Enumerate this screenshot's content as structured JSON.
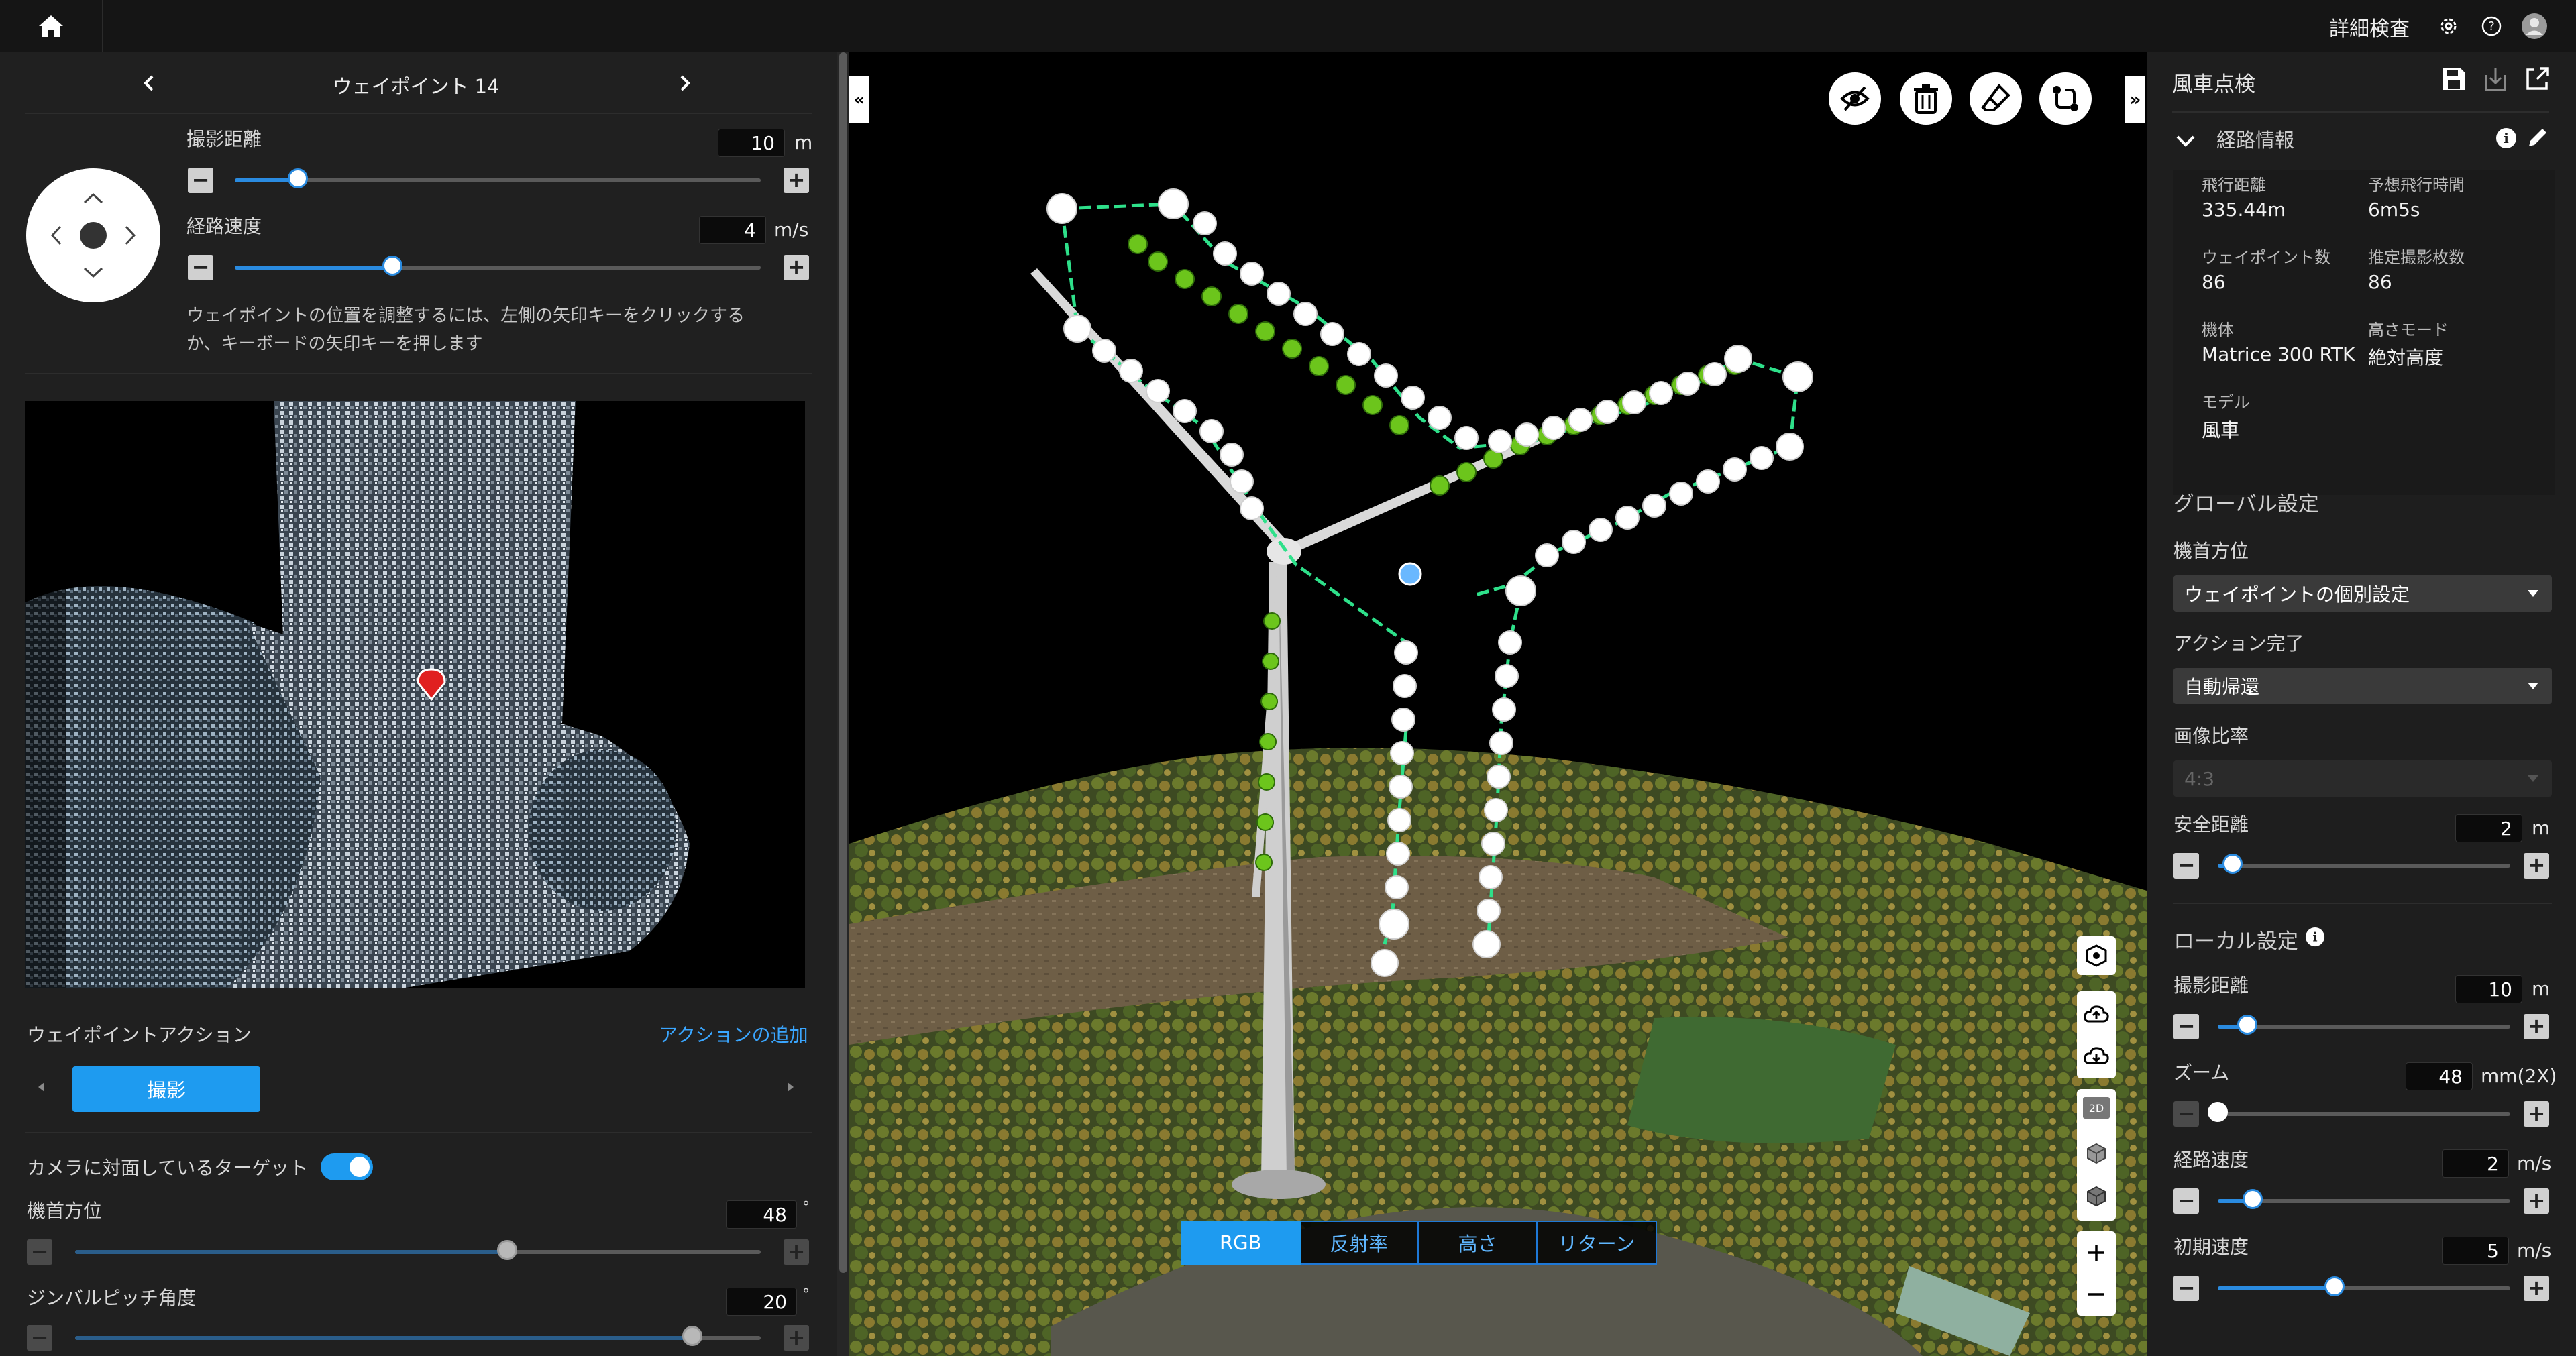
{
  "topbar": {
    "mode_label": "詳細検査",
    "icons": [
      "home-icon",
      "gear-icon",
      "help-icon",
      "user-icon"
    ]
  },
  "left_panel": {
    "title": "ウェイポイント 14",
    "shoot_distance": {
      "label": "撮影距離",
      "value": "10",
      "unit": "m",
      "level": 0.12
    },
    "route_speed": {
      "label": "経路速度",
      "value": "4",
      "unit": "m/s",
      "level": 0.3
    },
    "hint": [
      "ウェイポイントの位置を調整するには、左側の矢印キーをクリックする",
      "か、キーボードの矢印キーを押します"
    ],
    "actions": {
      "label": "ウェイポイントアクション",
      "add_link": "アクションの追加",
      "chip": "撮影"
    },
    "face_target": {
      "label": "カメラに対面しているターゲット",
      "enabled": true
    },
    "heading": {
      "label": "機首方位",
      "value": "48",
      "unit": "°",
      "level": 0.63
    },
    "gimbal_pitch": {
      "label": "ジンバルピッチ角度",
      "value": "20",
      "unit": "°",
      "level": 0.9
    }
  },
  "viewport": {
    "tools": [
      "eye-off-icon",
      "trash-icon",
      "eraser-icon",
      "route-swap-icon"
    ],
    "view_tools": [
      "cube-view-icon",
      "cloud-upload-icon",
      "cloud-download-icon",
      "2d-view-icon",
      "3d-box-icon",
      "3d-box-alt-icon",
      "zoom-in-icon",
      "zoom-out-icon"
    ],
    "view_2d_label": "2D",
    "color_modes": [
      "RGB",
      "反射率",
      "高さ",
      "リターン"
    ],
    "active_mode": "RGB"
  },
  "right_panel": {
    "title": "風車点検",
    "route_info": {
      "title": "経路情報",
      "items": [
        {
          "label": "飛行距離",
          "value": "335.44m"
        },
        {
          "label": "予想飛行時間",
          "value": "6m5s"
        },
        {
          "label": "ウェイポイント数",
          "value": "86"
        },
        {
          "label": "推定撮影枚数",
          "value": "86"
        },
        {
          "label": "機体",
          "value": "Matrice 300 RTK"
        },
        {
          "label": "高さモード",
          "value": "絶対高度"
        },
        {
          "label": "モデル",
          "value": "風車"
        }
      ]
    },
    "global": {
      "title": "グローバル設定",
      "heading_label": "機首方位",
      "heading_value": "ウェイポイントの個別設定",
      "finish_label": "アクション完了",
      "finish_value": "自動帰還",
      "ratio_label": "画像比率",
      "ratio_value": "4:3",
      "safe_distance": {
        "label": "安全距離",
        "value": "2",
        "unit": "m",
        "level": 0.05
      }
    },
    "local": {
      "title": "ローカル設定",
      "shoot_distance": {
        "label": "撮影距離",
        "value": "10",
        "unit": "m",
        "level": 0.1
      },
      "zoom": {
        "label": "ズーム",
        "value": "48",
        "unit": "mm(2X)",
        "level": 0.0
      },
      "route_speed": {
        "label": "経路速度",
        "value": "2",
        "unit": "m/s",
        "level": 0.12
      },
      "initial_speed": {
        "label": "初期速度",
        "value": "5",
        "unit": "m/s",
        "level": 0.4
      }
    }
  },
  "colors": {
    "accent": "#1e9bf0",
    "route_line": "#2ee08a",
    "marker_green": "#6cc51c"
  }
}
